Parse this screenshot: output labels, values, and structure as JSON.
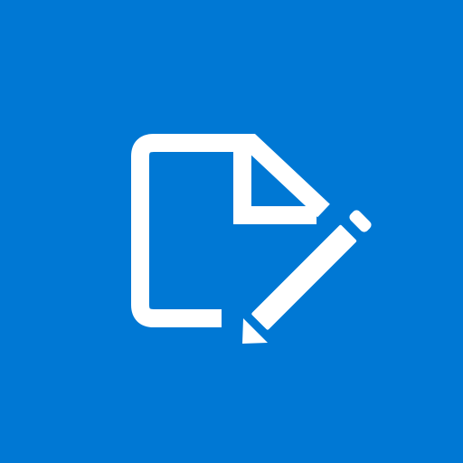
{
  "app_icon": {
    "icon": "edit-document-icon",
    "background_color": "#0078d4",
    "glyph_color": "#ffffff"
  }
}
